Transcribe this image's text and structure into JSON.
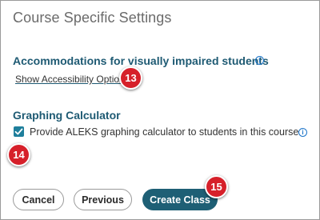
{
  "page": {
    "title": "Course Specific Settings"
  },
  "accessibility": {
    "heading": "Accommodations for visually impaired students",
    "info_icon": "i",
    "link_label": "Show Accessibility Options"
  },
  "graphing": {
    "heading": "Graphing Calculator",
    "checkbox_checked": true,
    "checkbox_label": "Provide ALEKS graphing calculator to students in this course",
    "info_icon": "i"
  },
  "buttons": {
    "cancel": "Cancel",
    "previous": "Previous",
    "create": "Create Class"
  },
  "callouts": {
    "a11y_link": "13",
    "checkbox": "14",
    "create_button": "15"
  },
  "colors": {
    "heading": "#1e5a73",
    "primary_button": "#1e5f75",
    "checkbox": "#1f7f9c",
    "callout": "#d6202a",
    "info_icon": "#1a73c8"
  },
  "icons": {
    "info": "info-circle-icon",
    "check": "checkmark-icon"
  }
}
